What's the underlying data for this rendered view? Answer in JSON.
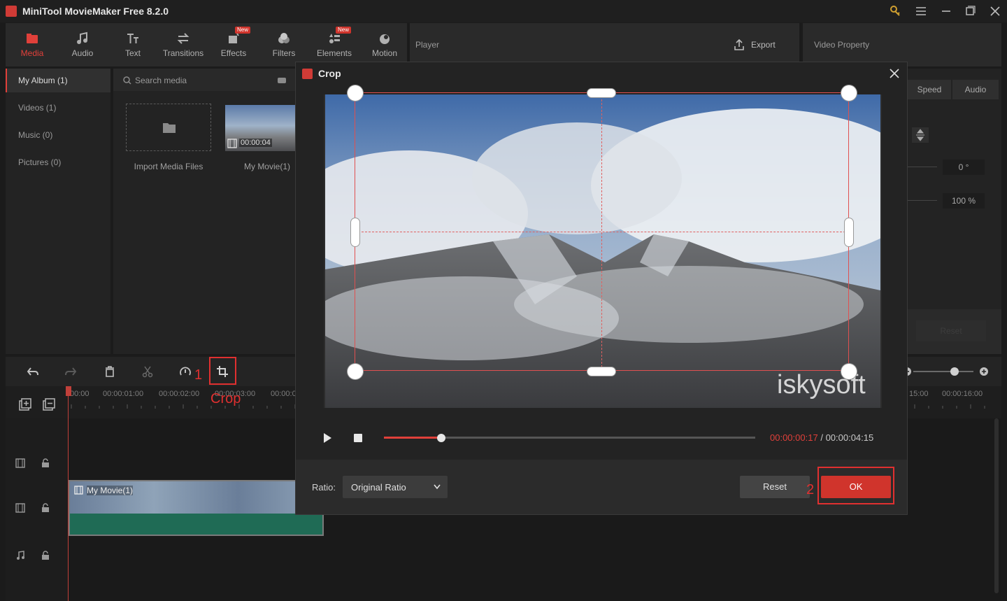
{
  "window": {
    "title": "MiniTool MovieMaker Free 8.2.0",
    "icons": [
      "app-logo-icon",
      "key-icon",
      "menu-icon",
      "minimize-icon",
      "maximize-icon",
      "close-icon"
    ]
  },
  "toolbar": {
    "tabs": [
      {
        "label": "Media",
        "icon": "media-icon",
        "active": true
      },
      {
        "label": "Audio",
        "icon": "audio-icon"
      },
      {
        "label": "Text",
        "icon": "text-icon"
      },
      {
        "label": "Transitions",
        "icon": "transitions-icon"
      },
      {
        "label": "Effects",
        "icon": "effects-icon",
        "badge": "New"
      },
      {
        "label": "Filters",
        "icon": "filters-icon"
      },
      {
        "label": "Elements",
        "icon": "elements-icon",
        "badge": "New"
      },
      {
        "label": "Motion",
        "icon": "motion-icon"
      }
    ]
  },
  "player": {
    "title": "Player",
    "export_label": "Export"
  },
  "video_property": {
    "title": "Video Property",
    "tabs": [
      "Speed",
      "Audio"
    ],
    "rotation_value": "0 °",
    "scale_value": "100 %",
    "reset_label": "Reset"
  },
  "album": {
    "items": [
      {
        "label": "My Album (1)",
        "selected": true
      },
      {
        "label": "Videos (1)"
      },
      {
        "label": "Music (0)"
      },
      {
        "label": "Pictures (0)"
      }
    ]
  },
  "media": {
    "search_placeholder": "Search media",
    "import_label": "Import Media Files",
    "clip_name": "My Movie(1)",
    "clip_duration": "00:00:04"
  },
  "timeline": {
    "ruler_labels": [
      "00:00",
      "00:00:01:00",
      "00:00:02:00",
      "00:00:03:00",
      "00:00:0",
      "15:00",
      "00:00:16:00"
    ],
    "clip_label": "My Movie(1)",
    "playhead_position_s": 0
  },
  "crop_dialog": {
    "title": "Crop",
    "watermark": "iskysoft",
    "current_time": "00:00:00:17",
    "separator": "/",
    "total_time": "00:00:04:15",
    "progress_percent": 15.5,
    "ratio_label": "Ratio:",
    "ratio_value": "Original Ratio",
    "reset_label": "Reset",
    "ok_label": "OK"
  },
  "annotations": {
    "step1": "1",
    "crop_label": "Crop",
    "step2": "2"
  },
  "colors": {
    "accent": "#e0403a",
    "ok_button": "#d0342c",
    "annotation": "#e03030",
    "time_current": "#e0403a"
  }
}
